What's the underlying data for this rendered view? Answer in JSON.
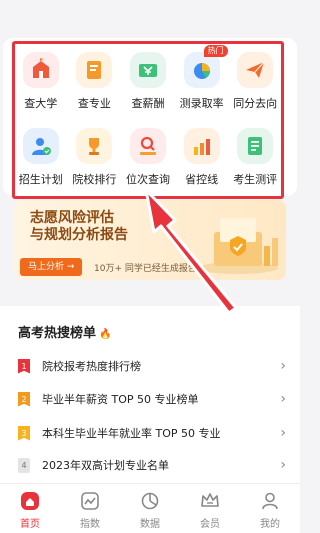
{
  "grid": {
    "items": [
      {
        "label": "查大学",
        "icon": "university-icon",
        "bg": "#fdeceb"
      },
      {
        "label": "查专业",
        "icon": "book-icon",
        "bg": "#fff2e0"
      },
      {
        "label": "查薪酬",
        "icon": "salary-icon",
        "bg": "#e6f6ee"
      },
      {
        "label": "测录取率",
        "icon": "pie-chart-icon",
        "bg": "#e8f1fc",
        "badge": "热门"
      },
      {
        "label": "同分去向",
        "icon": "paper-plane-icon",
        "bg": "#fff0e2"
      },
      {
        "label": "招生计划",
        "icon": "admission-plan-icon",
        "bg": "#e6f0fc"
      },
      {
        "label": "院校排行",
        "icon": "trophy-icon",
        "bg": "#fff4e0"
      },
      {
        "label": "位次查询",
        "icon": "rank-search-icon",
        "bg": "#fdeceb"
      },
      {
        "label": "省控线",
        "icon": "bar-chart-icon",
        "bg": "#fff1e2"
      },
      {
        "label": "考生测评",
        "icon": "test-icon",
        "bg": "#e6f6ec"
      }
    ]
  },
  "banner": {
    "title_line1": "志愿风险评估",
    "title_line2": "与规划分析报告",
    "button": "马上分析 →",
    "subtitle": "10万+ 同学已经生成报告"
  },
  "hot": {
    "title": "高考热搜榜单",
    "rows": [
      {
        "rank": "1",
        "text": "院校报考热度排行榜",
        "color": "#e8323c"
      },
      {
        "rank": "2",
        "text": "毕业半年薪资 TOP 50 专业榜单",
        "color": "#f39a1e"
      },
      {
        "rank": "3",
        "text": "本科生毕业半年就业率 TOP 50 专业",
        "color": "#f5b322"
      },
      {
        "rank": "4",
        "text": "2023年双高计划专业名单",
        "color": "#e4e4e4"
      }
    ]
  },
  "tabbar": {
    "tabs": [
      {
        "label": "首页",
        "icon": "home-icon"
      },
      {
        "label": "指数",
        "icon": "index-icon"
      },
      {
        "label": "数据",
        "icon": "data-icon"
      },
      {
        "label": "会员",
        "icon": "crown-icon"
      },
      {
        "label": "我的",
        "icon": "profile-icon"
      }
    ]
  },
  "colors": {
    "accent": "#e8323c",
    "annotation": "#e8323c"
  }
}
